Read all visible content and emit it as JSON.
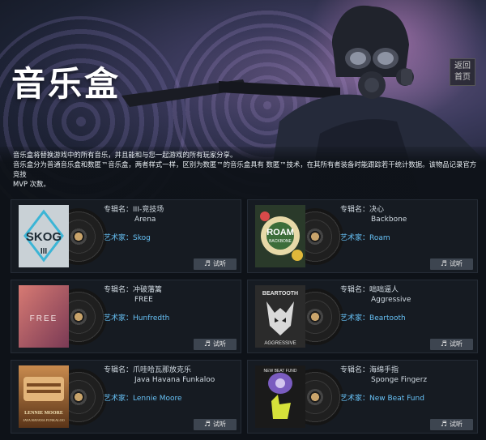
{
  "header": {
    "title": "音乐盒",
    "back_home_line1": "返回",
    "back_home_line2": "首页"
  },
  "description": {
    "line1": "音乐盒将替换游戏中的所有音乐，并且能和与您一起游戏的所有玩家分享。",
    "line2": "音乐盒分为普通音乐盒和数匿™音乐盒，两者样式一样，区别为数匿™的音乐盒具有 数匿™技术，在其所有者装备时能跟踪若干统计数据。该物品记录官方竞技",
    "line3": "MVP 次数。"
  },
  "labels": {
    "album": "专辑名：",
    "artist": "艺术家：",
    "listen": "试听"
  },
  "kits": [
    {
      "album": "III-竞技场",
      "title": "Arena",
      "artist": "Skog",
      "cover_text": "SKOG",
      "cover_sub": "III",
      "cover_bg": "#c9d1d6"
    },
    {
      "album": "决心",
      "title": "Backbone",
      "artist": "Roam",
      "cover_text": "ROAM",
      "cover_sub": "BACKBONE",
      "cover_bg": "#2a3a2a"
    },
    {
      "album": "冲破藩篱",
      "title": "FREE",
      "artist": "Hunfredth",
      "cover_text": "FREE",
      "cover_sub": "",
      "cover_bg": "#b85a63"
    },
    {
      "album": "咄咄逼人",
      "title": "Aggressive",
      "artist": "Beartooth",
      "cover_text": "BEARTOOTH",
      "cover_sub": "AGGRESSIVE",
      "cover_bg": "#2b2b2b"
    },
    {
      "album": "爪哇哈瓦那放克乐",
      "title": "Java Havana Funkaloo",
      "artist": "Lennie Moore",
      "cover_text": "LENNIE MOORE",
      "cover_sub": "JAVA HAVANA FUNKALOO",
      "cover_bg": "#7a5230"
    },
    {
      "album": "海绵手指",
      "title": "Sponge Fingerz",
      "artist": "New Beat Fund",
      "cover_text": "NEW BEAT FUND",
      "cover_sub": "",
      "cover_bg": "#1a1a1a"
    }
  ],
  "colors": {
    "accent_blue": "#67c1f5",
    "card_bg": "#161b22",
    "button_bg": "#3d4550"
  }
}
